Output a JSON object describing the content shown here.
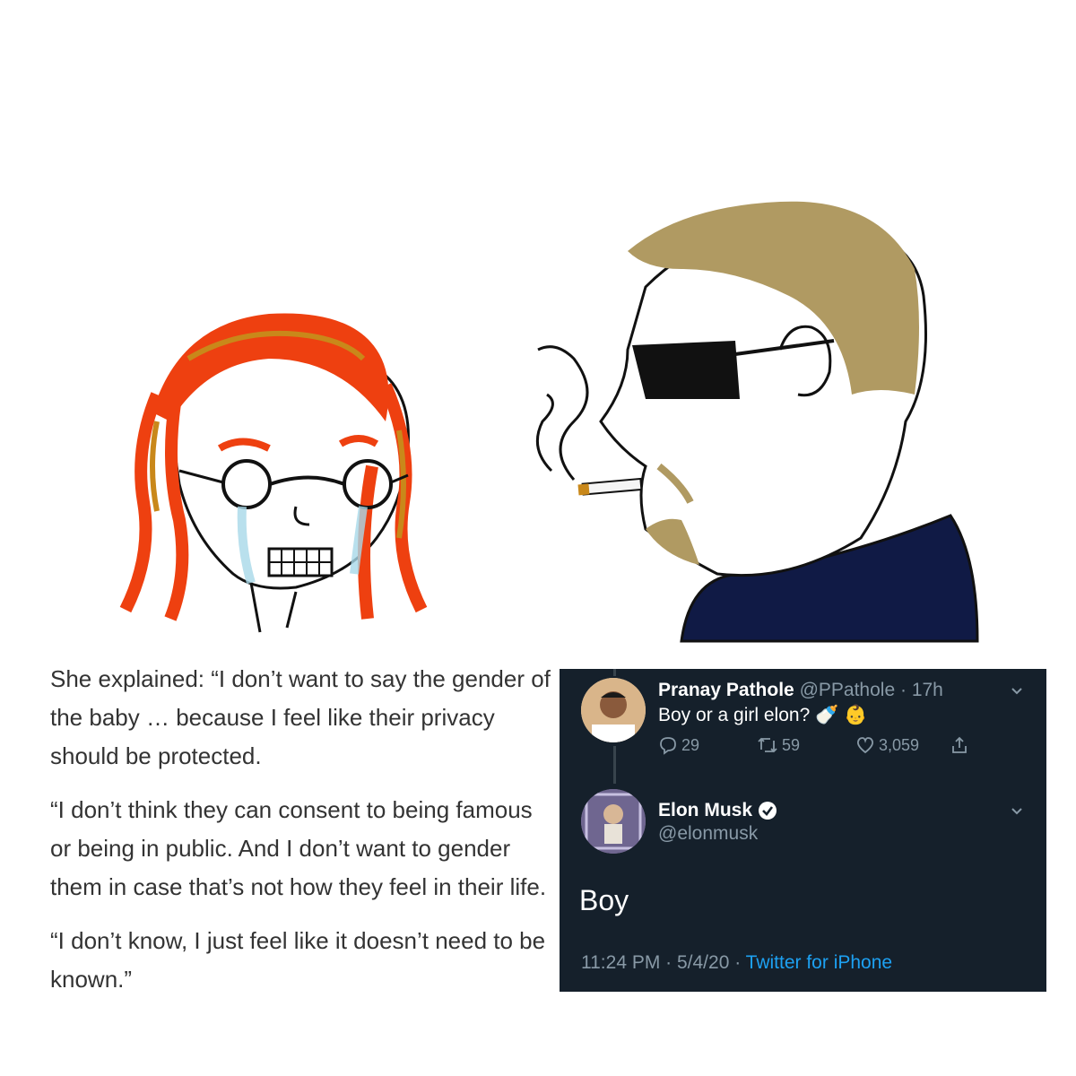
{
  "article": {
    "paragraphs": [
      "She explained: “I don’t want to say the gender of the baby … because I feel like their privacy should be protected.",
      "“I don’t think they can consent to being famous or being in public. And I don’t want to gender them in case that’s not how they feel in their life.",
      "“I don’t know, I just feel like it doesn’t need to be known.”"
    ]
  },
  "tweet": {
    "reply": {
      "name": "Pranay Pathole",
      "handle": "@PPathole",
      "time": "17h",
      "text": "Boy or a girl elon?",
      "emoji": "🍼 👶",
      "replies": "29",
      "retweets": "59",
      "likes": "3,059"
    },
    "main": {
      "name": "Elon Musk",
      "handle": "@elonmusk",
      "text": "Boy",
      "timestamp": "11:24 PM · 5/4/20 · ",
      "source": "Twitter for iPhone"
    },
    "colors": {
      "background": "#15202b",
      "muted": "#8899a6",
      "link": "#1da1f2"
    }
  }
}
